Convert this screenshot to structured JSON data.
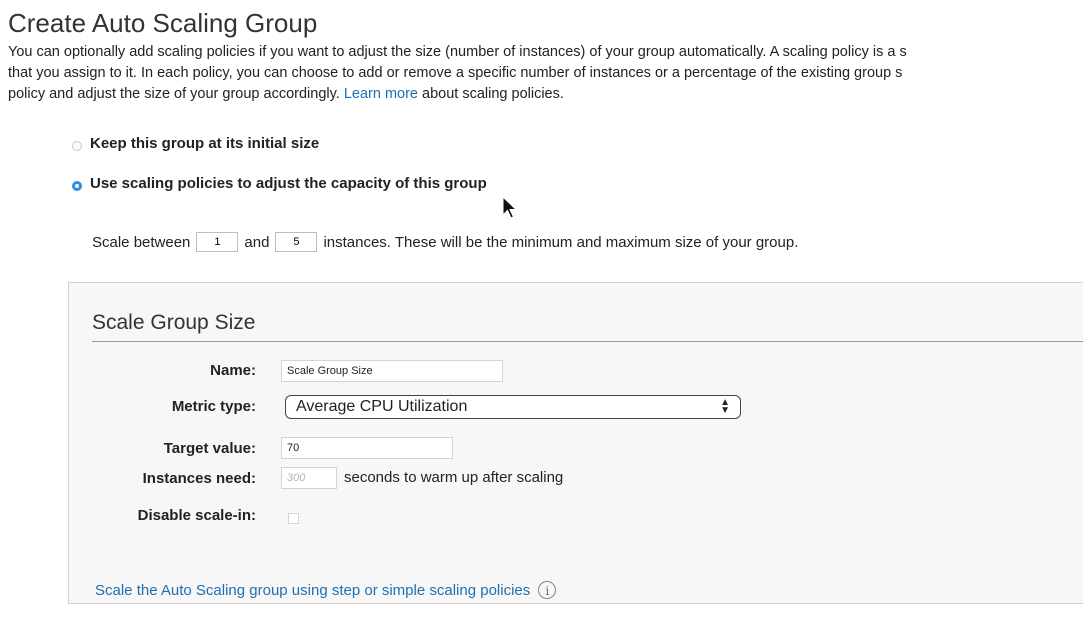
{
  "page": {
    "title": "Create Auto Scaling Group",
    "intro_line1": "You can optionally add scaling policies if you want to adjust the size (number of instances) of your group automatically. A scaling policy is a s",
    "intro_line2": "that you assign to it. In each policy, you can choose to add or remove a specific number of instances or a percentage of the existing group s",
    "intro_line3_before": "policy and adjust the size of your group accordingly. ",
    "intro_link": "Learn more",
    "intro_line3_after": " about scaling policies."
  },
  "options": {
    "keep_label": "Keep this group at its initial size",
    "use_policies_label": "Use scaling policies to adjust the capacity of this group",
    "selected": "use_policies"
  },
  "scale_range": {
    "prefix": "Scale between",
    "min": "1",
    "middle": "and",
    "max": "5",
    "suffix": "instances. These will be the minimum and maximum size of your group."
  },
  "policy": {
    "title": "Scale Group Size",
    "name_label": "Name:",
    "name_value": "Scale Group Size",
    "metric_label": "Metric type:",
    "metric_value": "Average CPU Utilization",
    "target_label": "Target value:",
    "target_value": "70",
    "warmup_label": "Instances need:",
    "warmup_placeholder": "300",
    "warmup_suffix": "seconds to warm up after scaling",
    "disable_label": "Disable scale-in:",
    "disable_checked": false,
    "step_link": "Scale the Auto Scaling group using step or simple scaling policies",
    "info_icon": "i"
  },
  "colors": {
    "link": "#1f6fb2",
    "radio_selected": "#2a8fe0",
    "panel_bg": "#f7f7f7"
  }
}
